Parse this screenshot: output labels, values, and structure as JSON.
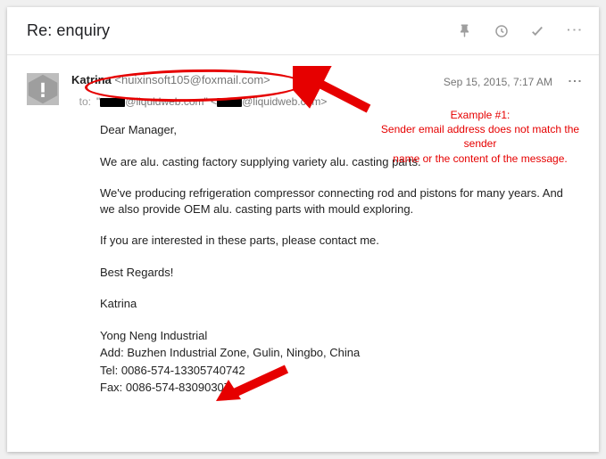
{
  "header": {
    "subject": "Re: enquiry"
  },
  "sender": {
    "name": "Katrina",
    "addr": "<huixinsoft105@foxmail.com>",
    "date": "Sep 15, 2015, 7:17 AM"
  },
  "to": {
    "label": "to:",
    "display_domain1": "@liquidweb.com\"",
    "display_domain2": "@liquidweb.com>"
  },
  "body": {
    "p1": "Dear Manager,",
    "p2": "We are alu. casting factory supplying variety alu. casting parts.",
    "p3": "We've producing refrigeration compressor connecting rod and pistons for many years. And we also provide OEM alu. casting parts with mould exploring.",
    "p4": "If you are interested in these parts, please contact me.",
    "p5": "Best Regards!",
    "p6": "Katrina",
    "sig1": "Yong Neng Industrial",
    "sig2": "Add: Buzhen Industrial Zone, Gulin, Ningbo, China",
    "sig3": "Tel: 0086-574-13305740742",
    "sig4": "Fax: 0086-574-83090307"
  },
  "annotation": {
    "title": "Example #1:",
    "line1": "Sender email address does not match the sender",
    "line2": "name or the content of the message."
  }
}
